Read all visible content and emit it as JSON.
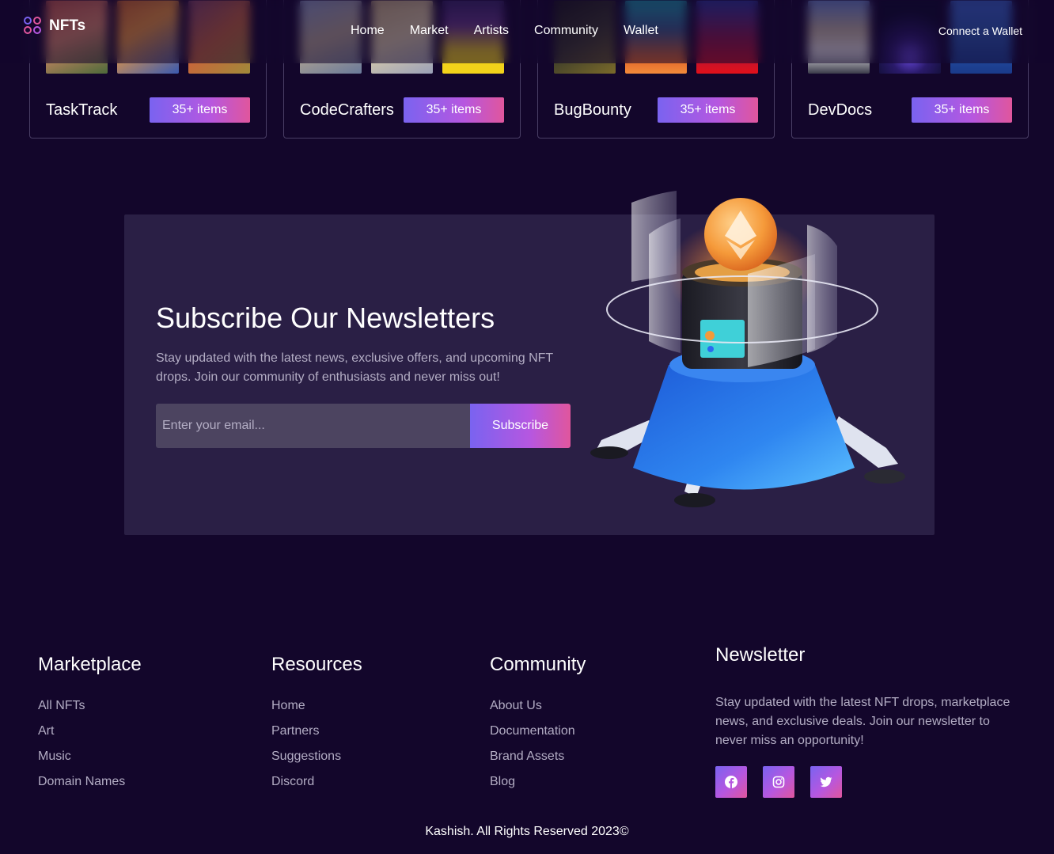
{
  "nav": {
    "logo": "NFTs",
    "links": [
      "Home",
      "Market",
      "Artists",
      "Community",
      "Wallet"
    ],
    "connect": "Connect a Wallet"
  },
  "collections": [
    {
      "name": "TaskTrack",
      "count": "35+ items"
    },
    {
      "name": "CodeCrafters",
      "count": "35+ items"
    },
    {
      "name": "BugBounty",
      "count": "35+ items"
    },
    {
      "name": "DevDocs",
      "count": "35+ items"
    }
  ],
  "hero": {
    "title": "Subscribe Our Newsletters",
    "description": "Stay updated with the latest news, exclusive offers, and upcoming NFT drops. Join our community of enthusiasts and never miss out!",
    "email_placeholder": "Enter your email...",
    "button": "Subscribe"
  },
  "footer": {
    "marketplace": {
      "title": "Marketplace",
      "items": [
        "All NFTs",
        "Art",
        "Music",
        "Domain Names"
      ]
    },
    "resources": {
      "title": "Resources",
      "items": [
        "Home",
        "Partners",
        "Suggestions",
        "Discord"
      ]
    },
    "community": {
      "title": "Community",
      "items": [
        "About Us",
        "Documentation",
        "Brand Assets",
        "Blog"
      ]
    },
    "newsletter": {
      "title": "Newsletter",
      "text": "Stay updated with the latest NFT drops, marketplace news, and exclusive deals. Join our newsletter to never miss an opportunity!",
      "socials": [
        "facebook-icon",
        "instagram-icon",
        "twitter-icon"
      ]
    },
    "copyright": "Kashish. All Rights Reserved 2023©"
  },
  "colors": {
    "background": "#13062b",
    "panel": "#2a1f45",
    "accent_start": "#7a63f0",
    "accent_end": "#e0569d"
  }
}
